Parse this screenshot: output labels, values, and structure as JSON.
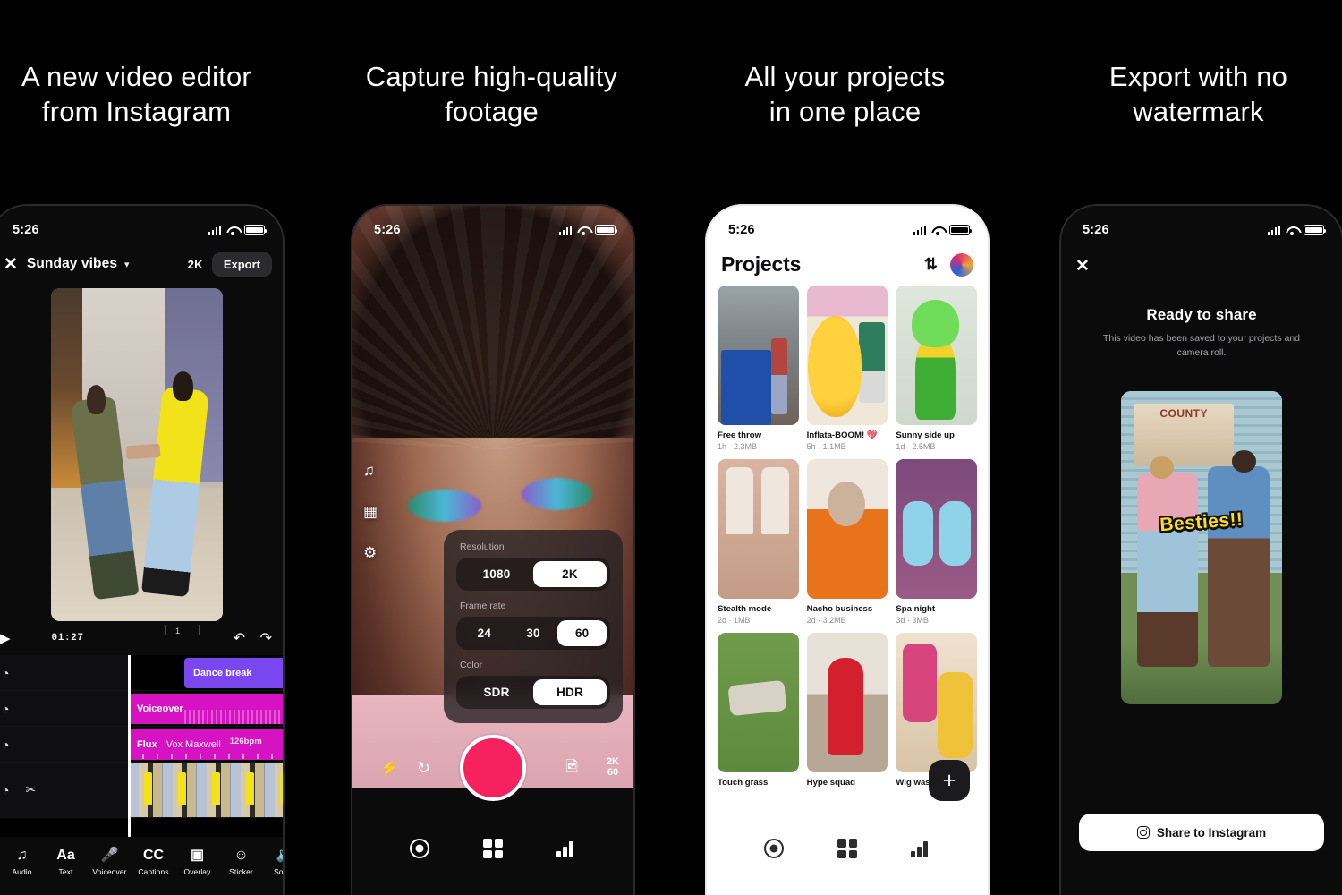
{
  "headlines": [
    {
      "line1": "A new video editor",
      "line2": "from Instagram"
    },
    {
      "line1": "Capture high-quality",
      "line2": "footage"
    },
    {
      "line1": "All your projects",
      "line2": "in one place"
    },
    {
      "line1": "Export with no",
      "line2": "watermark"
    }
  ],
  "status": {
    "time": "5:26"
  },
  "editor": {
    "close_label": "✕",
    "project_title": "Sunday vibes",
    "chevron": "▾",
    "quality": "2K",
    "export_label": "Export",
    "play_icon": "▶",
    "timecode": "01:27",
    "ruler_mark": "1",
    "undo_icon": "↶",
    "redo_icon": "↷",
    "tracks": [
      {
        "icon": "◔",
        "clip": "Dance break",
        "type": "overlay"
      },
      {
        "icon": "◔",
        "clip": "Voiceover",
        "type": "audio"
      },
      {
        "icon": "◔",
        "clip": "Flux",
        "artist": "Vox Maxwell",
        "bpm": "126bpm",
        "type": "music"
      },
      {
        "icon": "◔",
        "icon2": "✂",
        "clip": "",
        "type": "video"
      }
    ],
    "tools": [
      {
        "icon": "♫",
        "label": "Audio"
      },
      {
        "icon": "Aa",
        "label": "Text"
      },
      {
        "icon": "Ἲ4",
        "label": "Voiceover"
      },
      {
        "icon": "CC",
        "label": "Captions"
      },
      {
        "icon": "◱",
        "label": "Overlay"
      },
      {
        "icon": "☺",
        "label": "Sticker"
      },
      {
        "icon": "◔",
        "label": "Sound"
      }
    ]
  },
  "camera": {
    "rail": [
      {
        "icon": "♫",
        "name": "music-icon"
      },
      {
        "icon": "⊞",
        "name": "effects-icon"
      },
      {
        "icon": "⚙",
        "name": "settings-icon"
      }
    ],
    "settings": {
      "resolution": {
        "label": "Resolution",
        "options": [
          "1080",
          "2K"
        ],
        "selected": "2K"
      },
      "frame_rate": {
        "label": "Frame rate",
        "options": [
          "24",
          "30",
          "60"
        ],
        "selected": "60"
      },
      "color": {
        "label": "Color",
        "options": [
          "SDR",
          "HDR"
        ],
        "selected": "HDR"
      }
    },
    "controls": {
      "flash_icon": "⚡",
      "flip_icon": "↻",
      "gallery_icon": "ὛC",
      "mode_line1": "2K",
      "mode_line2": "60"
    },
    "record_color": "#f5225f"
  },
  "projects": {
    "title": "Projects",
    "sort_icon": "⇅",
    "add_label": "+",
    "items": [
      {
        "name": "Free throw",
        "meta": "1h · 2.3MB",
        "art": "t1"
      },
      {
        "name": "Inflata-BOOM! 💖",
        "meta": "5h · 1.1MB",
        "art": "t2"
      },
      {
        "name": "Sunny side up",
        "meta": "1d · 2.5MB",
        "art": "t3"
      },
      {
        "name": "Stealth mode",
        "meta": "2d · 1MB",
        "art": "t4"
      },
      {
        "name": "Nacho business",
        "meta": "2d · 3.2MB",
        "art": "t5"
      },
      {
        "name": "Spa night",
        "meta": "3d · 3MB",
        "art": "t6"
      },
      {
        "name": "Touch grass",
        "meta": "",
        "art": "t7"
      },
      {
        "name": "Hype squad",
        "meta": "",
        "art": "t8"
      },
      {
        "name": "Wig was snatched",
        "meta": "",
        "art": "t9"
      }
    ]
  },
  "export": {
    "close_label": "✕",
    "title": "Ready to share",
    "subtitle": "This video has been saved to your projects and camera roll.",
    "sticker": "Besties!!",
    "sign_text": "COUNTY",
    "share_label": "Share to Instagram"
  }
}
